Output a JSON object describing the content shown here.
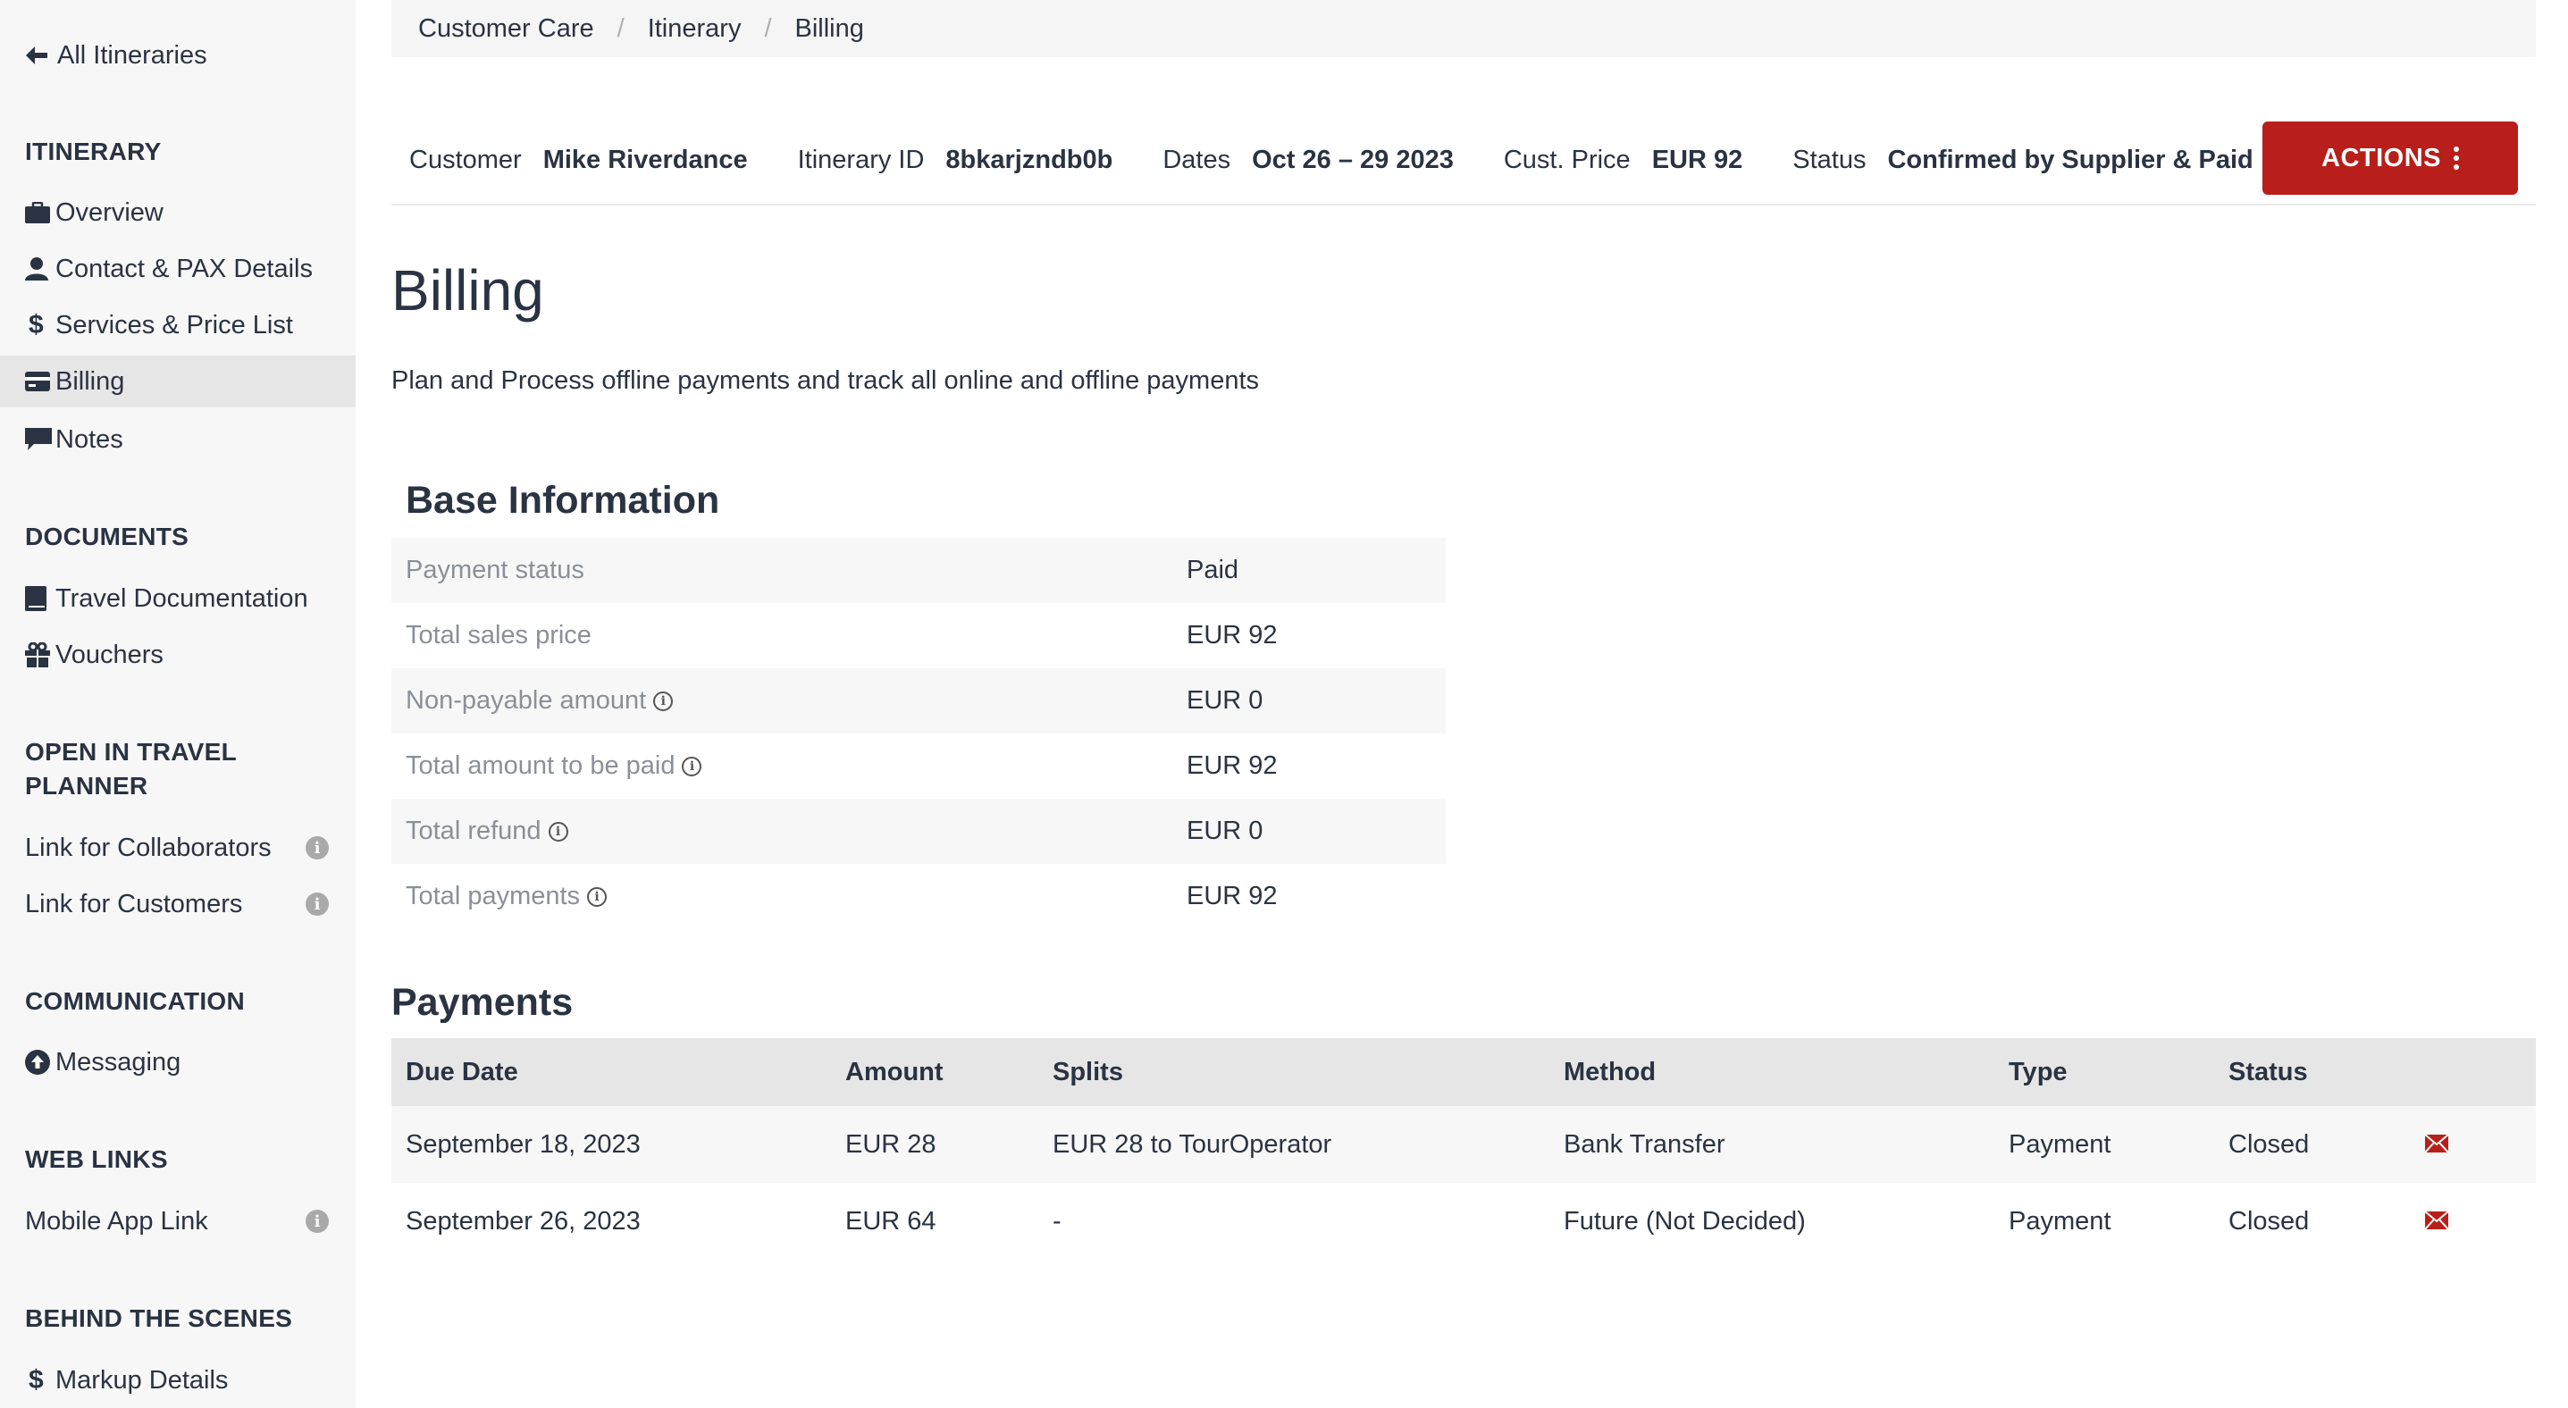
{
  "sidebar": {
    "back_label": "All Itineraries",
    "sections": {
      "itinerary": "ITINERARY",
      "documents": "DOCUMENTS",
      "open_line1": "OPEN IN TRAVEL",
      "open_line2": "PLANNER",
      "communication": "COMMUNICATION",
      "web_links": "WEB LINKS",
      "behind": "BEHIND THE SCENES"
    },
    "items": {
      "overview": "Overview",
      "contact": "Contact & PAX Details",
      "services": "Services & Price List",
      "billing": "Billing",
      "notes": "Notes",
      "travel_docs": "Travel Documentation",
      "vouchers": "Vouchers",
      "link_collaborators": "Link for Collaborators",
      "link_customers": "Link for Customers",
      "messaging": "Messaging",
      "mobile_app": "Mobile App Link",
      "markup": "Markup Details"
    }
  },
  "breadcrumb": [
    "Customer Care",
    "Itinerary",
    "Billing"
  ],
  "infobar": {
    "customer_label": "Customer",
    "customer_value": "Mike Riverdance",
    "id_label": "Itinerary ID",
    "id_value": "8bkarjzndb0b",
    "dates_label": "Dates",
    "dates_value": "Oct 26 – 29 2023",
    "price_label": "Cust. Price",
    "price_value": "EUR 92",
    "status_label": "Status",
    "status_value": "Confirmed by Supplier & Paid",
    "actions_label": "ACTIONS"
  },
  "page": {
    "title": "Billing",
    "description": "Plan and Process offline payments and track all online and offline payments"
  },
  "base_info": {
    "title": "Base Information",
    "rows": [
      {
        "label": "Payment status",
        "value": "Paid"
      },
      {
        "label": "Total sales price",
        "value": "EUR 92"
      },
      {
        "label": "Non-payable amount",
        "value": "EUR 0"
      },
      {
        "label": "Total amount to be paid",
        "value": "EUR 92"
      },
      {
        "label": "Total refund",
        "value": "EUR 0"
      },
      {
        "label": "Total payments",
        "value": "EUR 92"
      }
    ]
  },
  "payments": {
    "title": "Payments",
    "headers": [
      "Due Date",
      "Amount",
      "Splits",
      "Method",
      "Type",
      "Status"
    ],
    "rows": [
      {
        "due": "September 18, 2023",
        "amount": "EUR 28",
        "splits": "EUR 28 to TourOperator",
        "method": "Bank Transfer",
        "type": "Payment",
        "status": "Closed"
      },
      {
        "due": "September 26, 2023",
        "amount": "EUR 64",
        "splits": "-",
        "method": "Future (Not Decided)",
        "type": "Payment",
        "status": "Closed"
      }
    ]
  },
  "colors": {
    "accent": "#b81f1a",
    "text": "#2a3342",
    "muted": "#8a8f98"
  }
}
